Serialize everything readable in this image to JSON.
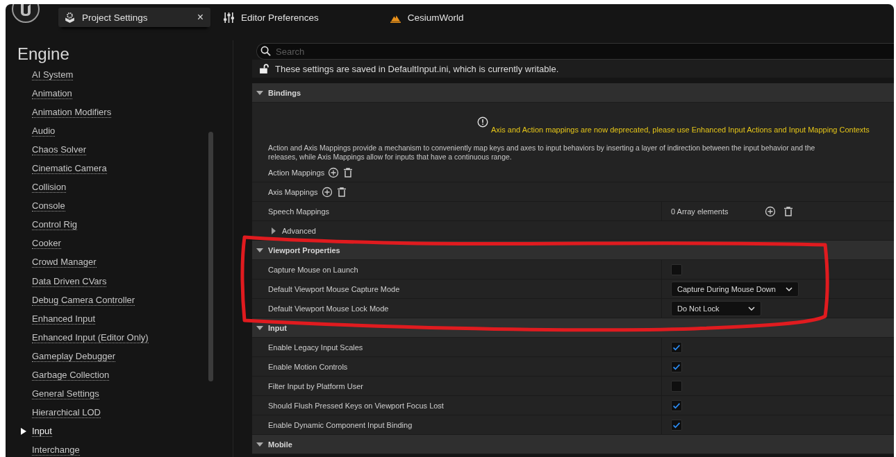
{
  "tabs": [
    {
      "kind": "settings",
      "label": "Project Settings",
      "selected": true,
      "closable": true,
      "close": "×"
    },
    {
      "kind": "preferences",
      "label": "Editor Preferences",
      "selected": false,
      "closable": false
    },
    {
      "kind": "level",
      "label": "CesiumWorld",
      "selected": false,
      "closable": false
    }
  ],
  "sidebar": {
    "title": "Engine",
    "items": [
      {
        "label": "AI System",
        "selected": false
      },
      {
        "label": "Animation",
        "selected": false
      },
      {
        "label": "Animation Modifiers",
        "selected": false
      },
      {
        "label": "Audio",
        "selected": false
      },
      {
        "label": "Chaos Solver",
        "selected": false
      },
      {
        "label": "Cinematic Camera",
        "selected": false
      },
      {
        "label": "Collision",
        "selected": false
      },
      {
        "label": "Console",
        "selected": false
      },
      {
        "label": "Control Rig",
        "selected": false
      },
      {
        "label": "Cooker",
        "selected": false
      },
      {
        "label": "Crowd Manager",
        "selected": false
      },
      {
        "label": "Data Driven CVars",
        "selected": false
      },
      {
        "label": "Debug Camera Controller",
        "selected": false
      },
      {
        "label": "Enhanced Input",
        "selected": false
      },
      {
        "label": "Enhanced Input (Editor Only)",
        "selected": false
      },
      {
        "label": "Gameplay Debugger",
        "selected": false
      },
      {
        "label": "Garbage Collection",
        "selected": false
      },
      {
        "label": "General Settings",
        "selected": false
      },
      {
        "label": "Hierarchical LOD",
        "selected": false
      },
      {
        "label": "Input",
        "selected": true
      },
      {
        "label": "Interchange",
        "selected": false
      }
    ]
  },
  "search": {
    "placeholder": "Search"
  },
  "notice": "These settings are saved in DefaultInput.ini, which is currently writable.",
  "sections": [
    {
      "title": "Bindings",
      "expanded": true,
      "warning": "Axis and Action mappings are now deprecated, please use Enhanced Input Actions and Input Mapping Contexts",
      "description": "Action and Axis Mappings provide a mechanism to conveniently map keys and axes to input behaviors by inserting a layer of indirection between the input behavior and the\nreleases, while Axis Mappings allow for inputs that have a continuous range.",
      "rows": [
        {
          "kind": "array",
          "label": "Action Mappings"
        },
        {
          "kind": "array",
          "label": "Axis Mappings"
        },
        {
          "kind": "array_value",
          "label": "Speech Mappings",
          "value": "0 Array elements"
        },
        {
          "kind": "group",
          "label": "Advanced",
          "expanded": false
        }
      ]
    },
    {
      "title": "Viewport Properties",
      "expanded": true,
      "rows": [
        {
          "kind": "checkbox",
          "label": "Capture Mouse on Launch",
          "checked": false
        },
        {
          "kind": "dropdown",
          "label": "Default Viewport Mouse Capture Mode",
          "value": "Capture During Mouse Down"
        },
        {
          "kind": "dropdown",
          "label": "Default Viewport Mouse Lock Mode",
          "value": "Do Not Lock"
        }
      ]
    },
    {
      "title": "Input",
      "expanded": true,
      "rows": [
        {
          "kind": "checkbox",
          "label": "Enable Legacy Input Scales",
          "checked": true
        },
        {
          "kind": "checkbox",
          "label": "Enable Motion Controls",
          "checked": true
        },
        {
          "kind": "checkbox",
          "label": "Filter Input by Platform User",
          "checked": false
        },
        {
          "kind": "checkbox",
          "label": "Should Flush Pressed Keys on Viewport Focus Lost",
          "checked": true
        },
        {
          "kind": "checkbox",
          "label": "Enable Dynamic Component Input Binding",
          "checked": true
        }
      ]
    },
    {
      "title": "Mobile",
      "expanded": true
    }
  ],
  "annotation": {
    "kind": "outline",
    "color": "#e01b1f"
  }
}
